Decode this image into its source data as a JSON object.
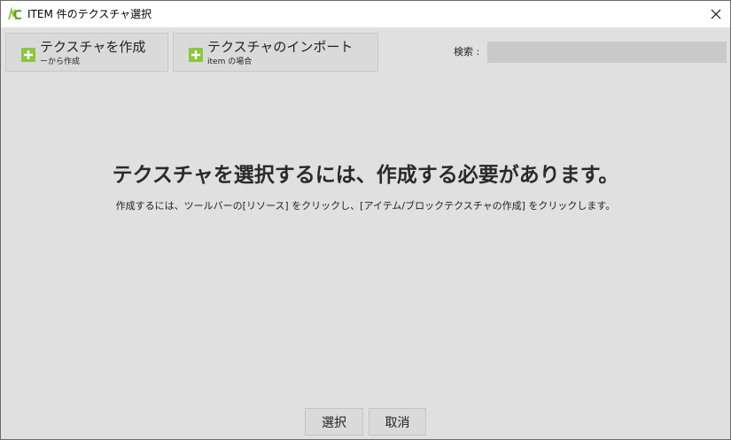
{
  "window": {
    "title": "ITEM 件のテクスチャ選択",
    "app_icon": "mcreator-logo-icon",
    "close_icon": "close-icon"
  },
  "toolbar": {
    "create": {
      "label": "テクスチャを作成",
      "sublabel": "ーから作成",
      "icon": "plus-icon"
    },
    "import": {
      "label": "テクスチャのインポート",
      "sublabel": "item の場合",
      "icon": "plus-icon"
    },
    "search": {
      "label": "検索 :",
      "value": ""
    }
  },
  "main": {
    "headline": "テクスチャを選択するには、作成する必要があります。",
    "hint": "作成するには、ツールバーの[リソース] をクリックし、[アイテム/ブロックテクスチャの作成] をクリックします。"
  },
  "footer": {
    "select_label": "選択",
    "cancel_label": "取消"
  },
  "colors": {
    "accent_green": "#8dc63f",
    "background": "#e0e0e0",
    "titlebar": "#ffffff"
  }
}
